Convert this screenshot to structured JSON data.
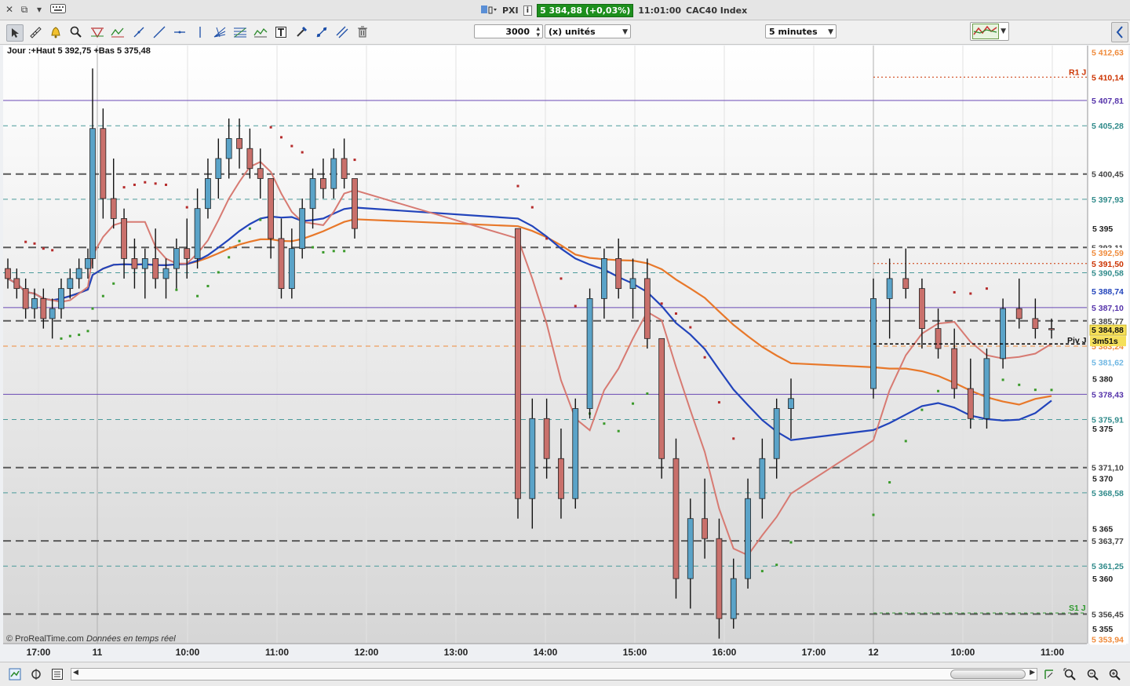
{
  "window": {
    "controls": [
      "✕",
      "⧉",
      "▾"
    ],
    "app_name": "PXI",
    "price_badge": "5 384,88 (+0,03%)",
    "time": "11:01:00",
    "instrument": "CAC40 Index"
  },
  "toolbar": {
    "units_value": "3000",
    "units_label": "(x) unités",
    "timeframe": "5 minutes"
  },
  "chart_header": "Jour :+Haut 5 392,75 +Bas 5 375,48",
  "footer": {
    "copyright": "© ProRealTime.com",
    "data_note": "Données en temps réel"
  },
  "colors": {
    "bull_candle": "#5aa3c8",
    "bear_candle": "#c9706b",
    "ma_blue": "#2244bb",
    "ma_orange": "#e8782a",
    "ma_red": "#d77a72",
    "psar_red": "#b52b2b",
    "psar_green": "#3a9a2a",
    "current_price_bg": "#f5e05a",
    "resistance_red": "#cc3300",
    "support_green": "#2f9a2f"
  },
  "chart_data": {
    "type": "candlestick",
    "instrument": "CAC40 Index",
    "timeframe": "5 minutes",
    "x_ticks": [
      "17:00",
      "11",
      "10:00",
      "11:00",
      "12:00",
      "13:00",
      "14:00",
      "15:00",
      "16:00",
      "17:00",
      "12",
      "10:00",
      "11:00"
    ],
    "y_ticks": [
      "5 395",
      "5 380",
      "5 375",
      "5 370",
      "5 365",
      "5 360",
      "5 355"
    ],
    "y_range": [
      5353.5,
      5413.3
    ],
    "price_levels": [
      {
        "label": "5 412,63",
        "color": "#ef8a3a"
      },
      {
        "label": "5 410,14",
        "color": "#cc3300"
      },
      {
        "label": "5 407,81",
        "color": "#5533aa"
      },
      {
        "label": "5 405,28",
        "color": "#2f8a8a"
      },
      {
        "label": "5 400,45",
        "color": "#555555"
      },
      {
        "label": "5 397,93",
        "color": "#2f8a8a"
      },
      {
        "label": "5 393,11",
        "color": "#555555"
      },
      {
        "label": "5 392,59",
        "color": "#ef8a3a"
      },
      {
        "label": "5 391,50",
        "color": "#cc3300"
      },
      {
        "label": "5 390,58",
        "color": "#2f8a8a"
      },
      {
        "label": "5 388,74",
        "color": "#2244bb"
      },
      {
        "label": "5 387,10",
        "color": "#5533aa"
      },
      {
        "label": "5 385,77",
        "color": "#555555"
      },
      {
        "label": "5 384,88",
        "color": "#f5e05a"
      },
      {
        "label": "5 383,24",
        "color": "#ef8a3a"
      },
      {
        "label": "5 381,62",
        "color": "#6fb7e3"
      },
      {
        "label": "5 378,43",
        "color": "#5533aa"
      },
      {
        "label": "5 375,91",
        "color": "#2f8a8a"
      },
      {
        "label": "5 371,10",
        "color": "#555555"
      },
      {
        "label": "5 368,58",
        "color": "#2f8a8a"
      },
      {
        "label": "5 363,77",
        "color": "#555555"
      },
      {
        "label": "5 361,25",
        "color": "#2f8a8a"
      },
      {
        "label": "5 356,56",
        "color": "#2f9a2f"
      },
      {
        "label": "5 356,45",
        "color": "#555555"
      },
      {
        "label": "5 353,94",
        "color": "#ef8a3a"
      }
    ],
    "countdown": "3m51s",
    "pivot_labels": {
      "resistance": "R1 J",
      "pivot": "Piv J",
      "support": "S1 J"
    },
    "candles_by_session": [
      {
        "session": "day 1 close",
        "ohlc": [
          [
            5391,
            5392,
            5389,
            5390
          ],
          [
            5390,
            5391,
            5388,
            5389
          ],
          [
            5389,
            5390,
            5386,
            5387
          ],
          [
            5387,
            5389,
            5386,
            5388
          ],
          [
            5388,
            5389,
            5385,
            5386
          ],
          [
            5386,
            5388,
            5384,
            5387
          ],
          [
            5387,
            5390,
            5386,
            5389
          ],
          [
            5389,
            5391,
            5388,
            5390
          ],
          [
            5390,
            5392,
            5389,
            5391
          ],
          [
            5391,
            5393,
            5390,
            5392
          ]
        ]
      },
      {
        "session": "11 morning",
        "ohlc": [
          [
            5392,
            5411,
            5391,
            5405
          ],
          [
            5405,
            5407,
            5396,
            5398
          ],
          [
            5398,
            5402,
            5395,
            5396
          ],
          [
            5396,
            5397,
            5390,
            5392
          ],
          [
            5392,
            5394,
            5389,
            5391
          ],
          [
            5391,
            5393,
            5388,
            5392
          ],
          [
            5392,
            5395,
            5389,
            5390
          ],
          [
            5390,
            5392,
            5388,
            5391
          ],
          [
            5391,
            5394,
            5389,
            5393
          ],
          [
            5393,
            5396,
            5390,
            5392
          ],
          [
            5392,
            5399,
            5391,
            5397
          ],
          [
            5397,
            5402,
            5396,
            5400
          ],
          [
            5400,
            5404,
            5398,
            5402
          ],
          [
            5402,
            5406,
            5400,
            5404
          ],
          [
            5404,
            5406,
            5401,
            5403
          ],
          [
            5403,
            5405,
            5400,
            5401
          ],
          [
            5401,
            5403,
            5398,
            5400
          ],
          [
            5400,
            5399,
            5392,
            5394
          ],
          [
            5394,
            5396,
            5388,
            5389
          ],
          [
            5389,
            5395,
            5388,
            5393
          ],
          [
            5393,
            5398,
            5392,
            5397
          ],
          [
            5397,
            5401,
            5395,
            5400
          ],
          [
            5400,
            5402,
            5398,
            5399
          ],
          [
            5399,
            5403,
            5398,
            5402
          ],
          [
            5402,
            5404,
            5399,
            5400
          ],
          [
            5400,
            5398,
            5394,
            5395
          ]
        ]
      },
      {
        "session": "11 afternoon",
        "ohlc": [
          [
            5395,
            5390,
            5366,
            5368
          ],
          [
            5368,
            5378,
            5365,
            5376
          ],
          [
            5376,
            5378,
            5370,
            5372
          ],
          [
            5372,
            5375,
            5366,
            5368
          ],
          [
            5368,
            5378,
            5367,
            5377
          ],
          [
            5377,
            5389,
            5376,
            5388
          ],
          [
            5388,
            5393,
            5386,
            5392
          ],
          [
            5392,
            5394,
            5388,
            5389
          ],
          [
            5389,
            5392,
            5386,
            5390
          ],
          [
            5390,
            5392,
            5383,
            5384
          ],
          [
            5384,
            5380,
            5370,
            5372
          ],
          [
            5372,
            5374,
            5358,
            5360
          ],
          [
            5360,
            5368,
            5357,
            5366
          ],
          [
            5366,
            5370,
            5362,
            5364
          ],
          [
            5364,
            5366,
            5354,
            5356
          ],
          [
            5356,
            5362,
            5355,
            5360
          ],
          [
            5360,
            5370,
            5359,
            5368
          ],
          [
            5368,
            5374,
            5366,
            5372
          ],
          [
            5372,
            5378,
            5370,
            5377
          ],
          [
            5377,
            5380,
            5374,
            5378
          ]
        ]
      },
      {
        "session": "12 morning",
        "ohlc": [
          [
            5379,
            5390,
            5378,
            5388
          ],
          [
            5388,
            5392,
            5384,
            5390
          ],
          [
            5390,
            5393,
            5388,
            5389
          ],
          [
            5389,
            5390,
            5383,
            5385
          ],
          [
            5385,
            5387,
            5382,
            5383
          ],
          [
            5383,
            5385,
            5378,
            5379
          ],
          [
            5379,
            5382,
            5375,
            5376
          ],
          [
            5376,
            5383,
            5375,
            5382
          ],
          [
            5382,
            5388,
            5381,
            5387
          ],
          [
            5387,
            5390,
            5385,
            5386
          ],
          [
            5386,
            5388,
            5384,
            5385
          ],
          [
            5385,
            5386,
            5384,
            5384.88
          ]
        ]
      }
    ],
    "grid": "horizontal dashed levels + vertical session separators",
    "legend": "none"
  }
}
